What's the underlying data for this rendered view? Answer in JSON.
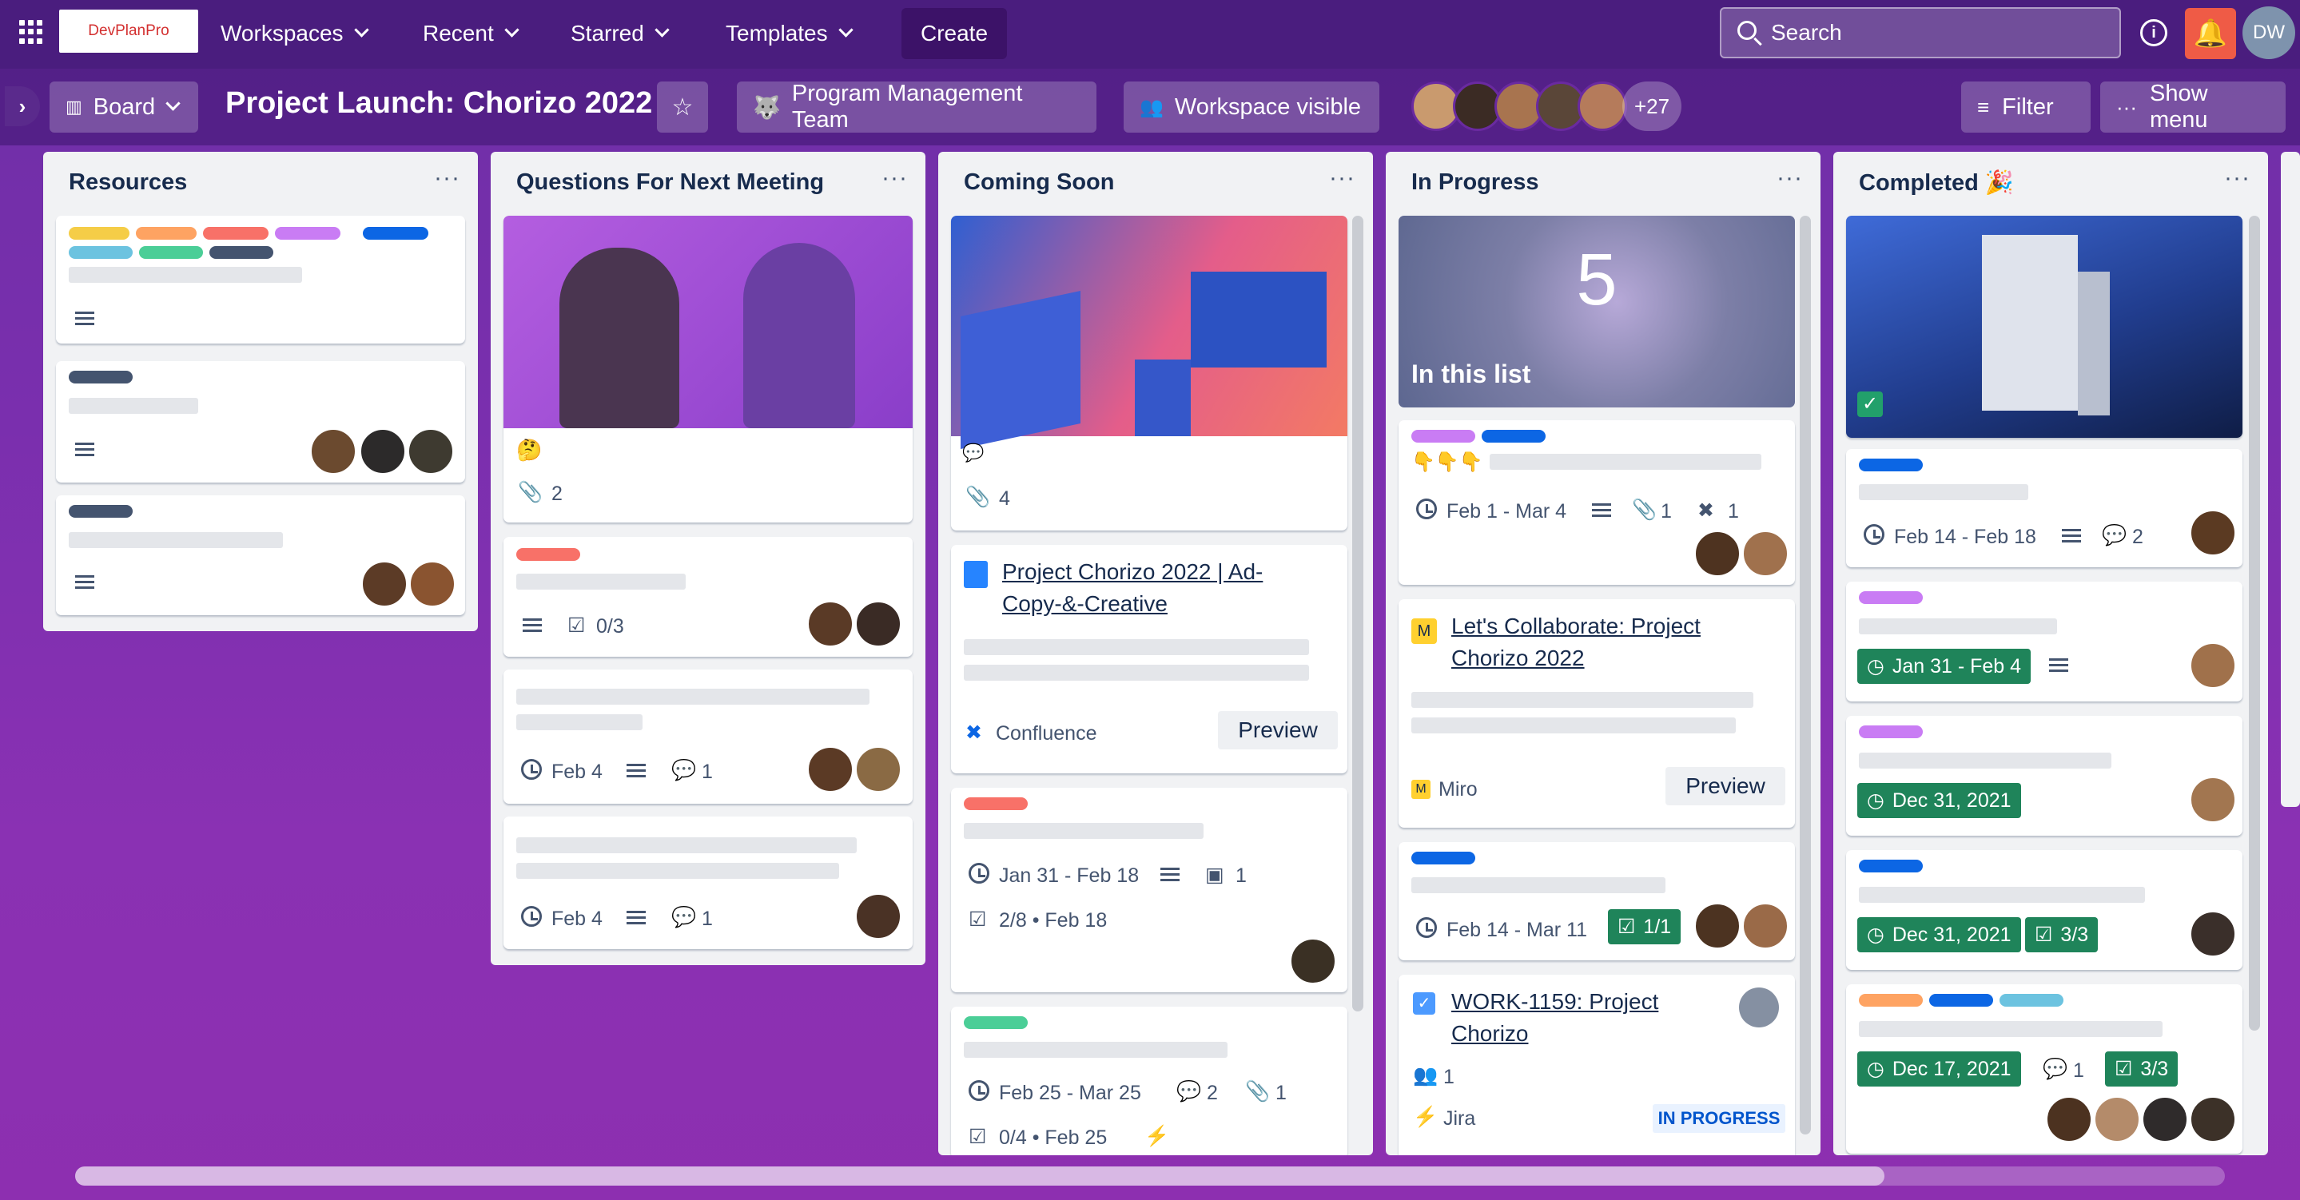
{
  "topbar": {
    "logo": "DevPlanPro",
    "workspaces": "Workspaces",
    "recent": "Recent",
    "starred": "Starred",
    "templates": "Templates",
    "create": "Create",
    "search": "Search",
    "info": "i",
    "user_initials": "DW"
  },
  "boardbar": {
    "view": "Board",
    "title": "Project Launch: Chorizo 2022",
    "team": "Program Management Team",
    "visibility": "Workspace visible",
    "more_members": "+27",
    "filter": "Filter",
    "show_menu": "Show menu"
  },
  "lists": {
    "resources": {
      "title": "Resources"
    },
    "questions": {
      "title": "Questions For Next Meeting",
      "c1_emoji": "🤔",
      "c1_attach": "2",
      "c2_check": "0/3",
      "c3_date": "Feb 4",
      "c3_comments": "1",
      "c4_date": "Feb 4",
      "c4_comments": "1"
    },
    "coming": {
      "title": "Coming Soon",
      "c1_attach": "4",
      "c2_link": "Project Chorizo 2022 | Ad-Copy-&-Creative",
      "c2_source": "Confluence",
      "c2_preview": "Preview",
      "c3_date": "Jan 31 - Feb 18",
      "c3_count": "1",
      "c3_check": "2/8 • Feb 18",
      "c4_date": "Feb 25 - Mar 25",
      "c4_comments": "2",
      "c4_attach": "1",
      "c4_check": "0/4 • Feb 25"
    },
    "progress": {
      "title": "In Progress",
      "cover_number": "5",
      "cover_text": "In this list",
      "c1_emoji": "👇👇👇",
      "c1_date": "Feb 1 - Mar 4",
      "c1_attach": "1",
      "c1_count": "1",
      "c2_link": "Let's Collaborate: Project Chorizo 2022",
      "c2_source": "Miro",
      "c2_preview": "Preview",
      "c3_date": "Feb 14 - Mar 11",
      "c3_check": "1/1",
      "c4_link": "WORK-1159: Project Chorizo",
      "c4_people": "1",
      "c4_source": "Jira",
      "c4_status": "IN PROGRESS"
    },
    "completed": {
      "title": "Completed 🎉",
      "c1_date": "Feb 14 - Feb 18",
      "c1_comments": "2",
      "c2_date": "Jan 31 - Feb 4",
      "c3_date": "Dec 31, 2021",
      "c4_date": "Dec 31, 2021",
      "c4_check": "3/3",
      "c5_date": "Dec 17, 2021",
      "c5_comments": "1",
      "c5_check": "3/3"
    }
  },
  "colors": {
    "topbar": "#4a1d7e",
    "card_bg": "#ffffff",
    "list_bg": "#f1f2f4",
    "done_green": "#1f845a",
    "bell": "#ef5b46"
  }
}
